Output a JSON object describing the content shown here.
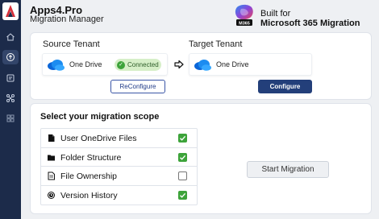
{
  "app": {
    "title": "Apps4.Pro",
    "subtitle": "Migration Manager"
  },
  "badge": {
    "line1": "Built for",
    "line2": "Microsoft 365 Migration",
    "logo_caption": "M365"
  },
  "sidebar": {
    "items": [
      {
        "name": "home-icon",
        "active": false
      },
      {
        "name": "cloud-upload-icon",
        "active": true
      },
      {
        "name": "report-icon",
        "active": false
      },
      {
        "name": "connections-icon",
        "active": false
      },
      {
        "name": "grid-icon",
        "active": false
      }
    ]
  },
  "source": {
    "label": "Source Tenant",
    "service": "One Drive",
    "status": "Connected",
    "button": "ReConfigure"
  },
  "target": {
    "label": "Target Tenant",
    "service": "One Drive",
    "button": "Configure"
  },
  "scope": {
    "title": "Select your migration scope",
    "items": [
      {
        "label": "User OneDrive Files",
        "checked": true
      },
      {
        "label": "Folder Structure",
        "checked": true
      },
      {
        "label": "File Ownership",
        "checked": false
      },
      {
        "label": "Version History",
        "checked": true
      }
    ]
  },
  "actions": {
    "start": "Start Migration"
  },
  "colors": {
    "sidebar": "#1c2b4a",
    "primary": "#233f7a",
    "success": "#3da33a",
    "connected_bg": "#d6efc8"
  }
}
